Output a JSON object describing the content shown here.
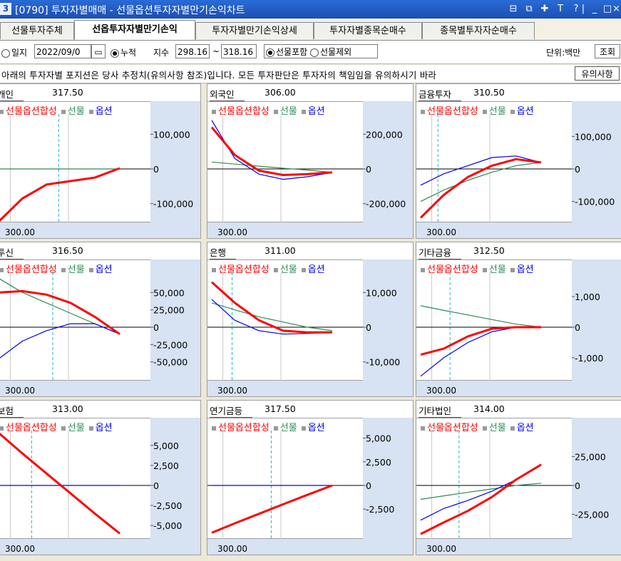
{
  "window": {
    "badge": "3",
    "title": "[0790] 투자자별매매 - 선물옵션투자자별만기손익차트",
    "controls": [
      "⊟",
      "⧉",
      "✚",
      "T",
      "?",
      "|",
      "_",
      "□",
      "×"
    ]
  },
  "tabs": [
    {
      "label": "선물투자주체",
      "active": false
    },
    {
      "label": "선옵투자자별만기손익",
      "active": true
    },
    {
      "label": "투자자별만기손익상세",
      "active": false
    },
    {
      "label": "투자자별종목순매수",
      "active": false
    },
    {
      "label": "종목별투자자순매수",
      "active": false
    }
  ],
  "filters": {
    "daily_label": "일지",
    "date_value": "2022/09/0",
    "cumulative_label": "누적",
    "index_label": "지수",
    "index_from": "298.16",
    "range_sep": "~",
    "index_to": "318.16",
    "futures_include": "선물포함",
    "futures_exclude": "선물제외",
    "unit_label": "단위:백만",
    "query_button": "조회"
  },
  "notice": {
    "text": "아래의 투자자별 포지션은 당사 추정치(유의사항 참조)입니다. 모든 투자판단은 투자자의 책임임을 유의하시기 바라",
    "button": "유의사항"
  },
  "legend": {
    "combined": "선물옵션합성",
    "futures": "선물",
    "options": "옵션"
  },
  "colors": {
    "combined": "#ff0000",
    "futures": "#2e8b57",
    "options": "#0000ee",
    "axis_bg": "#d7e2f2"
  },
  "panels": [
    {
      "name": "개인",
      "value": "317.50",
      "xtick": "300.00",
      "yticks": [
        "100,000",
        "0",
        "-100,000"
      ]
    },
    {
      "name": "외국인",
      "value": "306.00",
      "xtick": "300.00",
      "yticks": [
        "200,000",
        "0",
        "-200,000"
      ]
    },
    {
      "name": "금융투자",
      "value": "310.50",
      "xtick": "300.00",
      "yticks": [
        "100,000",
        "0",
        "-100,000"
      ]
    },
    {
      "name": "투신",
      "value": "316.50",
      "xtick": "300.00",
      "yticks": [
        "50,000",
        "25,000",
        "0",
        "-25,000",
        "-50,000"
      ]
    },
    {
      "name": "은행",
      "value": "311.00",
      "xtick": "300.00",
      "yticks": [
        "10,000",
        "0",
        "-10,000"
      ]
    },
    {
      "name": "기타금융",
      "value": "312.50",
      "xtick": "300.00",
      "yticks": [
        "1,000",
        "0",
        "-1,000"
      ]
    },
    {
      "name": "보험",
      "value": "313.00",
      "xtick": "300.00",
      "yticks": [
        "5,000",
        "2,500",
        "0",
        "-2,500",
        "-5,000"
      ]
    },
    {
      "name": "연기금등",
      "value": "317.50",
      "xtick": "300.00",
      "yticks": [
        "5,000",
        "2,500",
        "0",
        "-2,500"
      ]
    },
    {
      "name": "기타법인",
      "value": "314.00",
      "xtick": "300.00",
      "yticks": [
        "25,000",
        "0",
        "-25,000"
      ]
    }
  ],
  "chart_data": {
    "type": "line",
    "x_range": [
      298.16,
      318.16
    ],
    "x_tick": 300.0,
    "panels": [
      {
        "name": "개인",
        "ylim": [
          -150000,
          150000
        ],
        "x": [
          298.16,
          302,
          306,
          310,
          314,
          318.16
        ],
        "series": [
          {
            "name": "선물옵션합성",
            "values": [
              -150000,
              -85000,
              -45000,
              -35000,
              -25000,
              2000
            ]
          },
          {
            "name": "선물",
            "values": [
              0,
              0,
              0,
              0,
              0,
              0
            ]
          },
          {
            "name": "옵션",
            "values": [
              -150000,
              -85000,
              -45000,
              -35000,
              -25000,
              2000
            ]
          }
        ]
      },
      {
        "name": "외국인",
        "ylim": [
          -300000,
          300000
        ],
        "x": [
          298.16,
          302,
          306,
          310,
          314,
          318.16
        ],
        "series": [
          {
            "name": "선물옵션합성",
            "values": [
              240000,
              80000,
              -10000,
              -35000,
              -30000,
              -20000
            ]
          },
          {
            "name": "선물",
            "values": [
              40000,
              28000,
              16000,
              4000,
              -6000,
              -20000
            ]
          },
          {
            "name": "옵션",
            "values": [
              280000,
              60000,
              -30000,
              -60000,
              -45000,
              -20000
            ]
          }
        ]
      },
      {
        "name": "금융투자",
        "ylim": [
          -160000,
          160000
        ],
        "x": [
          298.16,
          302,
          306,
          310,
          314,
          318.16
        ],
        "series": [
          {
            "name": "선물옵션합성",
            "values": [
              -150000,
              -80000,
              -25000,
              10000,
              30000,
              20000
            ]
          },
          {
            "name": "선물",
            "values": [
              -100000,
              -65000,
              -35000,
              -10000,
              10000,
              20000
            ]
          },
          {
            "name": "옵션",
            "values": [
              -50000,
              -15000,
              10000,
              35000,
              40000,
              20000
            ]
          }
        ]
      },
      {
        "name": "투신",
        "ylim": [
          -75000,
          75000
        ],
        "x": [
          298.16,
          302,
          306,
          310,
          314,
          318.16
        ],
        "series": [
          {
            "name": "선물옵션합성",
            "values": [
              50000,
              52000,
              47000,
              35000,
              15000,
              -10000
            ]
          },
          {
            "name": "선물",
            "values": [
              70000,
              50000,
              35000,
              20000,
              5000,
              -10000
            ]
          },
          {
            "name": "옵션",
            "values": [
              -45000,
              -20000,
              -5000,
              5000,
              5000,
              -10000
            ]
          }
        ]
      },
      {
        "name": "은행",
        "ylim": [
          -15000,
          15000
        ],
        "x": [
          298.16,
          302,
          306,
          310,
          314,
          318.16
        ],
        "series": [
          {
            "name": "선물옵션합성",
            "values": [
              13000,
              7000,
              2000,
              -1000,
              -1500,
              -1500
            ]
          },
          {
            "name": "선물",
            "values": [
              7000,
              5000,
              3000,
              1500,
              0,
              -1000
            ]
          },
          {
            "name": "옵션",
            "values": [
              8000,
              2000,
              -1000,
              -2000,
              -1800,
              -1500
            ]
          }
        ]
      },
      {
        "name": "기타금융",
        "ylim": [
          -1700,
          1700
        ],
        "x": [
          298.16,
          302,
          306,
          310,
          314,
          318.16
        ],
        "series": [
          {
            "name": "선물옵션합성",
            "values": [
              -900,
              -700,
              -300,
              -50,
              0,
              0
            ]
          },
          {
            "name": "선물",
            "values": [
              700,
              550,
              400,
              250,
              100,
              0
            ]
          },
          {
            "name": "옵션",
            "values": [
              -1600,
              -1000,
              -500,
              -150,
              0,
              0
            ]
          }
        ]
      },
      {
        "name": "보험",
        "ylim": [
          -6500,
          6500
        ],
        "x": [
          298.16,
          302,
          306,
          310,
          314,
          318.16
        ],
        "series": [
          {
            "name": "선물옵션합성",
            "values": [
              6500,
              4000,
              1500,
              -1000,
              -3500,
              -6000
            ]
          },
          {
            "name": "선물",
            "values": [
              6500,
              4000,
              1500,
              -1000,
              -3500,
              -6000
            ]
          },
          {
            "name": "옵션",
            "values": [
              0,
              0,
              0,
              0,
              0,
              0
            ]
          }
        ]
      },
      {
        "name": "연기금등",
        "ylim": [
          -5500,
          5500
        ],
        "x": [
          298.16,
          302,
          306,
          310,
          314,
          318.16
        ],
        "series": [
          {
            "name": "선물옵션합성",
            "values": [
              -5000,
              -4000,
              -3000,
              -2000,
              -1000,
              0
            ]
          },
          {
            "name": "선물",
            "values": [
              -5000,
              -4000,
              -3000,
              -2000,
              -1000,
              0
            ]
          },
          {
            "name": "옵션",
            "values": [
              0,
              0,
              0,
              0,
              0,
              0
            ]
          }
        ]
      },
      {
        "name": "기타법인",
        "ylim": [
          -45000,
          45000
        ],
        "x": [
          298.16,
          302,
          306,
          310,
          314,
          318.16
        ],
        "series": [
          {
            "name": "선물옵션합성",
            "values": [
              -42000,
              -32000,
              -22000,
              -10000,
              5000,
              18000
            ]
          },
          {
            "name": "선물",
            "values": [
              -12000,
              -9000,
              -6000,
              -3000,
              0,
              2000
            ]
          },
          {
            "name": "옵션",
            "values": [
              -30000,
              -20000,
              -13000,
              -5000,
              5000,
              18000
            ]
          }
        ]
      }
    ]
  }
}
